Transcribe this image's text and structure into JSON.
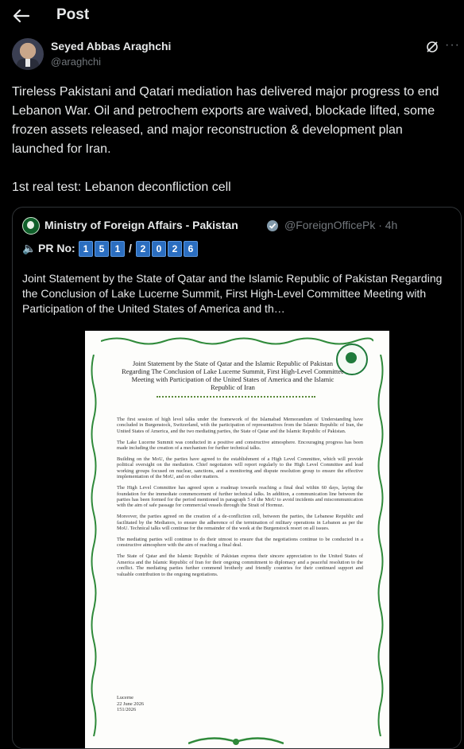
{
  "header": {
    "title": "Post"
  },
  "author": {
    "name": "Seyed Abbas Araghchi",
    "handle": "@araghchi"
  },
  "post": {
    "paragraph1": "Tireless Pakistani and Qatari mediation has delivered major progress to end Lebanon War. Oil and petrochem exports are waived, blockade lifted, some frozen assets released, and major reconstruction & development plan launched for Iran.",
    "paragraph2": "1st real test: Lebanon deconfliction cell"
  },
  "quoted": {
    "name": "Ministry of Foreign Affairs - Pakistan",
    "handle_time": "@ForeignOfficePk · 4h",
    "pr_label": "PR No:",
    "pr_digits_a": [
      "1",
      "5",
      "1"
    ],
    "pr_digits_b": [
      "2",
      "0",
      "2",
      "6"
    ],
    "text": "Joint Statement by the State of Qatar and the Islamic Republic of Pakistan Regarding the Conclusion of Lake Lucerne Summit, First High-Level Committee Meeting with Participation of the United States of America and th…"
  },
  "document": {
    "title": "Joint Statement by the State of Qatar and the Islamic Republic of Pakistan Regarding The Conclusion of Lake Lucerne Summit, First High-Level Committee Meeting with Participation of the United States of America and the Islamic Republic of Iran",
    "p1": "The first session of high level talks under the framework of the Islamabad Memorandum of Understanding have concluded in Burgenstock, Switzerland, with the participation of representatives from the Islamic Republic of Iran, the United States of America, and the two mediating parties, the State of Qatar and the Islamic Republic of Pakistan.",
    "p2": "The Lake Lucerne Summit was conducted in a positive and constructive atmosphere. Encouraging progress has been made including the creation of a mechanism for further technical talks.",
    "p3": "Building on the MoU, the parties have agreed to the establishment of a High Level Committee, which will provide political oversight on the mediation. Chief negotiators will report regularly to the High Level Committee and lead working groups focused on nuclear, sanctions, and a monitoring and dispute resolution group to ensure the effective implementation of the MoU, and on other matters.",
    "p4": "The High Level Committee has agreed upon a roadmap towards reaching a final deal within 60 days, laying the foundation for the immediate commencement of further technical talks. In addition, a communication line between the parties has been formed for the period mentioned in paragraph 5 of the MoU to avoid incidents and miscommunication with the aim of safe passage for commercial vessels through the Strait of Hormuz.",
    "p5": "Moreover, the parties agreed on the creation of a de-confliction cell, between the parties, the Lebanese Republic and facilitated by the Mediators, to ensure the adherence of the termination of military operations in Lebanon as per the MoU. Technical talks will continue for the remainder of the week at the Burgenstock resort on all issues.",
    "p6": "The mediating parties will continue to do their utmost to ensure that the negotiations continue to be conducted in a constructive atmosphere with the aim of reaching a final deal.",
    "p7": "The State of Qatar and the Islamic Republic of Pakistan express their sincere appreciation to the United States of America and the Islamic Republic of Iran for their ongoing commitment to diplomacy and a peaceful resolution to the conflict. The mediating parties further commend brotherly and friendly countries for their continued support and valuable contribution to the ongoing negotiations.",
    "place": "Lucerne",
    "date": "22 June 2026",
    "number": "151/2026"
  },
  "colors": {
    "accent": "#1d9bf0",
    "verified_gold": "#e2b719",
    "pr_blue": "#2b6ec0",
    "doc_green": "#2f8a3a"
  },
  "icons": {
    "back": "arrow-left-icon",
    "grok": "grok-icon",
    "more": "more-icon",
    "verified": "verified-badge-icon",
    "speaker": "speaker-icon"
  }
}
